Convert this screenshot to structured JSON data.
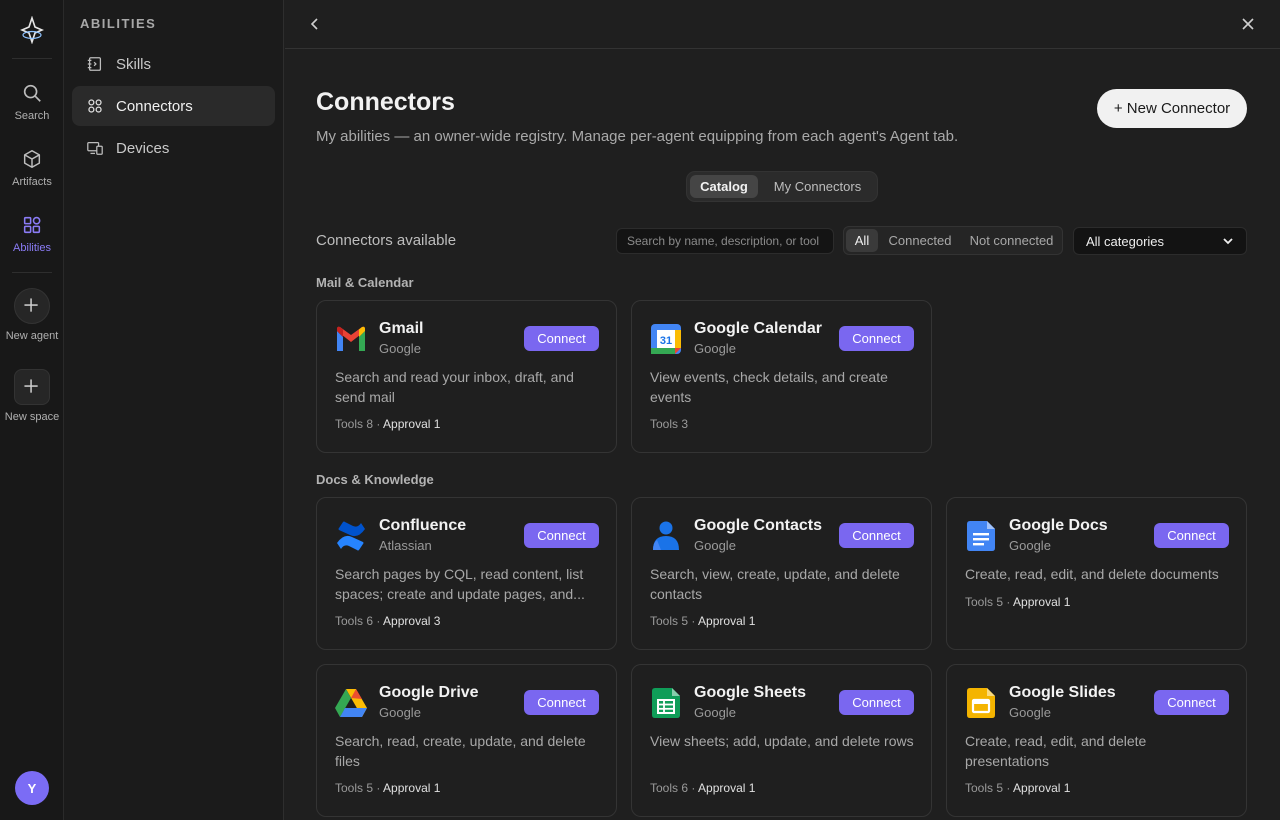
{
  "rail": {
    "items": [
      {
        "label": "Search",
        "icon": "search-icon"
      },
      {
        "label": "Artifacts",
        "icon": "cube-icon"
      },
      {
        "label": "Abilities",
        "icon": "grid-icon",
        "active": true
      },
      {
        "label": "New agent",
        "icon": "plus-icon"
      },
      {
        "label": "New space",
        "icon": "plus-icon"
      }
    ],
    "avatar": "Y"
  },
  "sidebar": {
    "title": "ABILITIES",
    "items": [
      {
        "label": "Skills",
        "icon": "skills-icon"
      },
      {
        "label": "Connectors",
        "icon": "connectors-icon",
        "active": true
      },
      {
        "label": "Devices",
        "icon": "devices-icon"
      }
    ]
  },
  "header": {
    "title": "Connectors",
    "subtitle": "My abilities — an owner-wide registry. Manage per-agent equipping from each agent's Agent tab.",
    "new_button": "+ New Connector"
  },
  "tabs": {
    "catalog": "Catalog",
    "my": "My Connectors",
    "selected": "Catalog"
  },
  "toolbar": {
    "available_label": "Connectors available",
    "search_placeholder": "Search by name, description, or tool",
    "filters": [
      "All",
      "Connected",
      "Not connected"
    ],
    "selected_filter": "All",
    "category": "All categories"
  },
  "sections": {
    "mail": "Mail & Calendar",
    "docs": "Docs & Knowledge"
  },
  "connect_label": "Connect",
  "cards": [
    {
      "name": "Gmail",
      "vendor": "Google",
      "desc": "Search and read your inbox, draft, and send mail",
      "tools": "Tools 8",
      "approval": "Approval 1",
      "icon": "gmail-icon"
    },
    {
      "name": "Google Calendar",
      "vendor": "Google",
      "desc": "View events, check details, and create events",
      "tools": "Tools 3",
      "approval": "",
      "icon": "google-calendar-icon"
    },
    {
      "name": "Confluence",
      "vendor": "Atlassian",
      "desc": "Search pages by CQL, read content, list spaces; create and update pages, and...",
      "tools": "Tools 6",
      "approval": "Approval 3",
      "icon": "confluence-icon"
    },
    {
      "name": "Google Contacts",
      "vendor": "Google",
      "desc": "Search, view, create, update, and delete contacts",
      "tools": "Tools 5",
      "approval": "Approval 1",
      "icon": "google-contacts-icon"
    },
    {
      "name": "Google Docs",
      "vendor": "Google",
      "desc": "Create, read, edit, and delete documents",
      "tools": "Tools 5",
      "approval": "Approval 1",
      "icon": "google-docs-icon"
    },
    {
      "name": "Google Drive",
      "vendor": "Google",
      "desc": "Search, read, create, update, and delete files",
      "tools": "Tools 5",
      "approval": "Approval 1",
      "icon": "google-drive-icon"
    },
    {
      "name": "Google Sheets",
      "vendor": "Google",
      "desc": "View sheets; add, update, and delete rows",
      "tools": "Tools 6",
      "approval": "Approval 1",
      "icon": "google-sheets-icon"
    },
    {
      "name": "Google Slides",
      "vendor": "Google",
      "desc": "Create, read, edit, and delete presentations",
      "tools": "Tools 5",
      "approval": "Approval 1",
      "icon": "google-slides-icon"
    }
  ],
  "colors": {
    "accent": "#7a67f0",
    "active_rail": "#8b7cf6"
  }
}
